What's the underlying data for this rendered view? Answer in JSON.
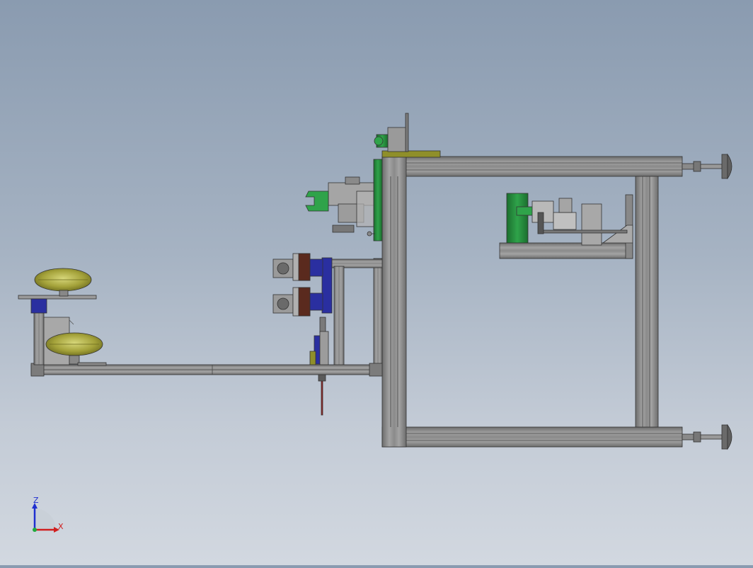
{
  "view": {
    "type": "cad-side-view",
    "background_top": "#8a9bb0",
    "background_bottom": "#d2d8e0"
  },
  "triad": {
    "z_label": "Z",
    "x_label": "X",
    "z_color": "#1f2fd0",
    "x_color": "#d01f1f",
    "origin_color": "#1faa3c"
  },
  "colors": {
    "profile": "#8e8e8e",
    "profile_dark": "#5a5a5a",
    "green_part": "#1f8a3a",
    "olive_part": "#8f8f2a",
    "blue_part": "#2a2fa0",
    "red_rod": "#a01e1e",
    "yellow_part": "#b0b040"
  },
  "components": [
    "main-frame",
    "top-mounted-motor",
    "gripper-assembly",
    "vertical-cylinder-stack",
    "horizontal-beam",
    "reel-station",
    "drive-unit",
    "leveling-feet"
  ]
}
